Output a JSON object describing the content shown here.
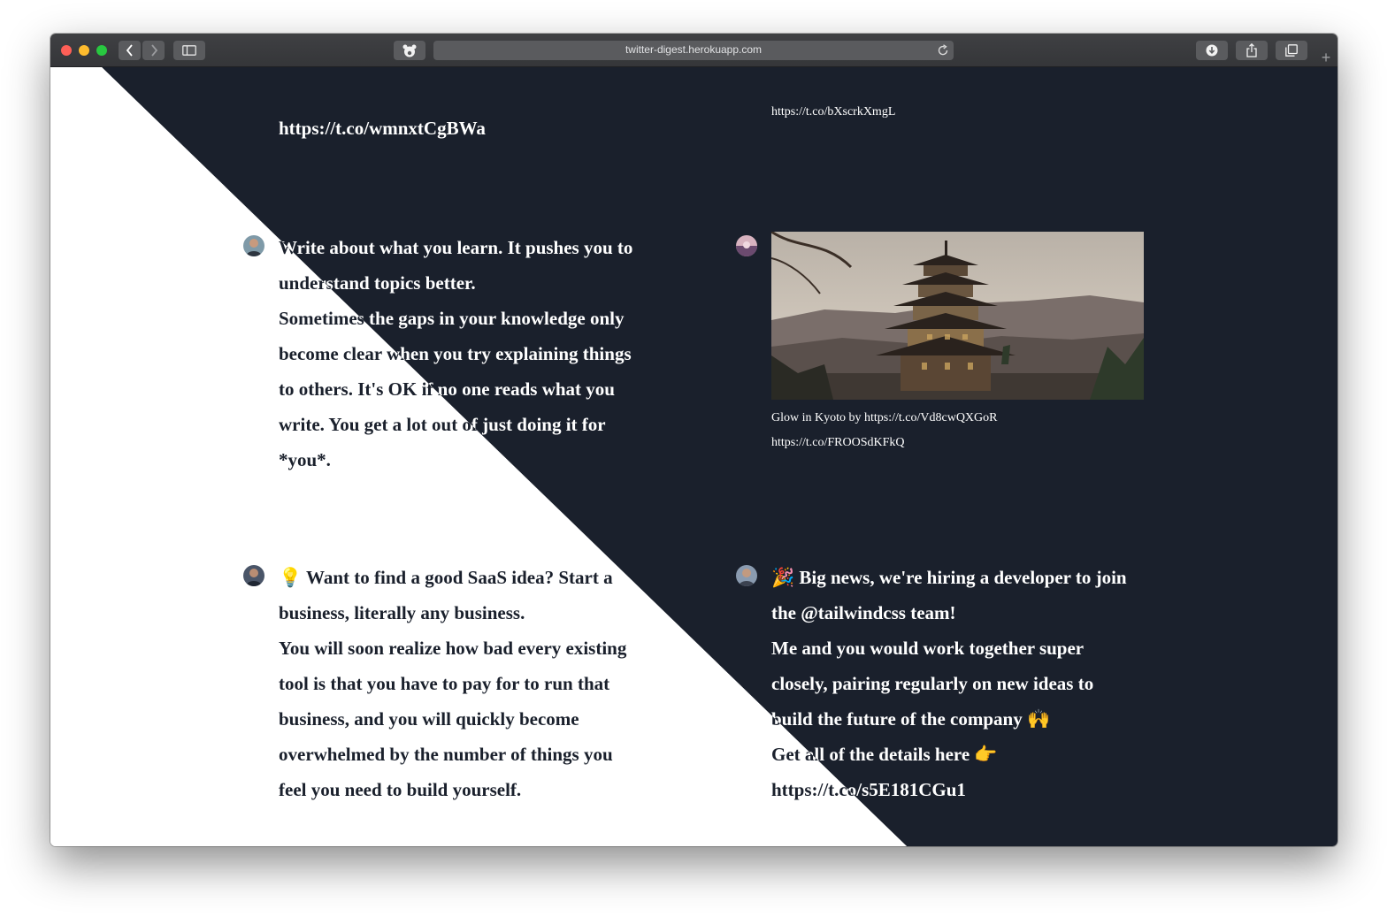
{
  "window": {
    "url": "twitter-digest.herokuapp.com"
  },
  "tweets": {
    "top_left_link": "https://t.co/wmnxtCgBWa",
    "top_right_link": "https://t.co/bXscrkXmgL",
    "tweet1": {
      "lines": [
        "Write about what you learn. It pushes you to",
        "understand topics better.",
        "Sometimes the gaps in your knowledge only",
        "become clear when you try explaining things",
        "to others. It's OK if no one reads what you",
        "write. You get a lot out of just doing it for",
        "*you*."
      ]
    },
    "tweet2": {
      "image_alt": "Pagoda in Kyoto at sunset",
      "caption_lines": [
        "Glow in Kyoto by https://t.co/Vd8cwQXGoR",
        "https://t.co/FROOSdKFkQ"
      ]
    },
    "tweet3": {
      "lines": [
        "💡 Want to find a good SaaS idea? Start a",
        "business, literally any business.",
        "You will soon realize how bad every existing",
        "tool is that you have to pay for to run that",
        "business, and you will quickly become",
        "overwhelmed by the number of things you",
        "feel you need to build yourself."
      ]
    },
    "tweet4": {
      "lines": [
        "🎉 Big news, we're hiring a developer to join",
        "the @tailwindcss team!",
        "Me and you would work together super",
        "closely, pairing regularly on new ideas to",
        "build the future of the company 🙌",
        "Get all of the details here 👉",
        "https://t.co/s5E181CGu1"
      ]
    }
  },
  "colors": {
    "dark_bg": "#1a202c",
    "light_bg": "#ffffff",
    "dark_text": "#1a202c",
    "light_text": "#ffffff"
  },
  "icons": {
    "back": "chevron-left-icon",
    "forward": "chevron-right-icon",
    "sidebar": "sidebar-icon",
    "extension": "bear-icon",
    "reload": "reload-icon",
    "download": "download-icon",
    "share": "share-icon",
    "tabs": "tabs-icon",
    "new_tab": "plus-icon"
  }
}
